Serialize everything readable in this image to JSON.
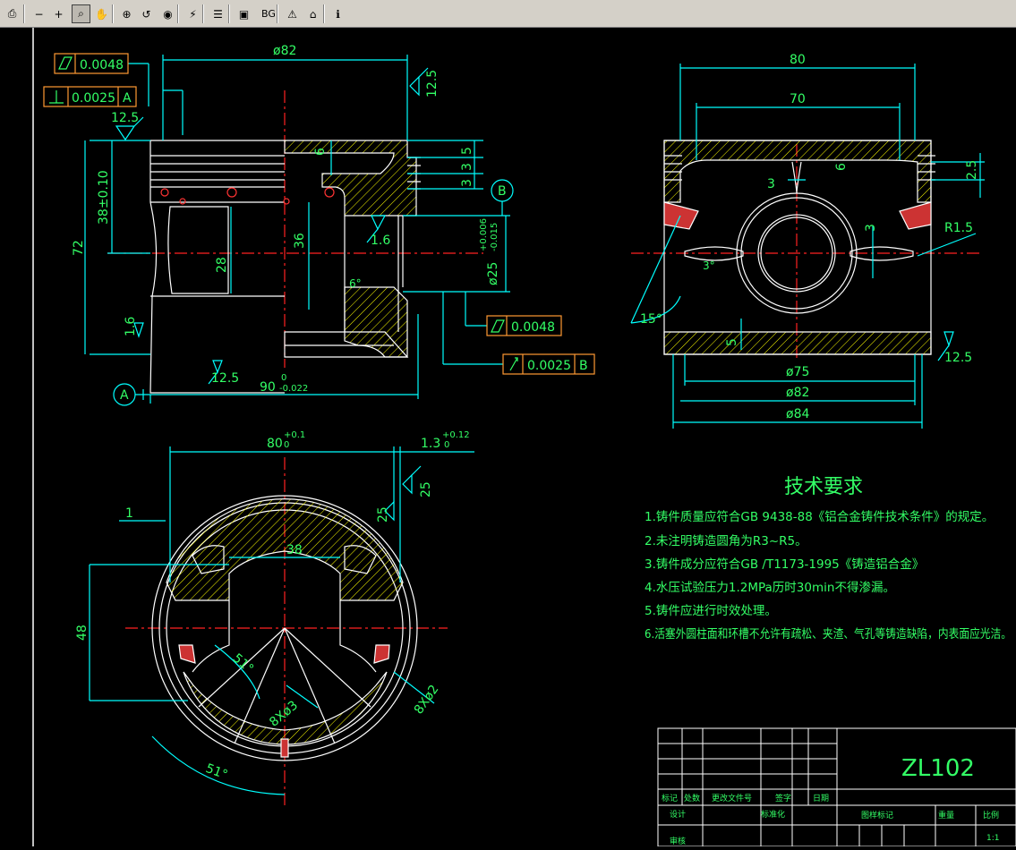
{
  "toolbar": {
    "buttons": [
      {
        "name": "print-icon",
        "glyph": "⎙"
      },
      {
        "name": "zoom-out-icon",
        "glyph": "−"
      },
      {
        "name": "zoom-in-icon",
        "glyph": "+"
      },
      {
        "name": "zoom-window-icon",
        "glyph": "⌕"
      },
      {
        "name": "pan-icon",
        "glyph": "✋"
      },
      {
        "name": "zoom-extents-icon",
        "glyph": "⊕"
      },
      {
        "name": "zoom-previous-icon",
        "glyph": "↺"
      },
      {
        "name": "orbit-icon",
        "glyph": "◉"
      },
      {
        "name": "redraw-icon",
        "glyph": "⚡"
      },
      {
        "name": "layers-icon",
        "glyph": "☰"
      },
      {
        "name": "view-icon",
        "glyph": "▣"
      },
      {
        "name": "background-label",
        "glyph": "BG"
      },
      {
        "name": "warning-icon",
        "glyph": "⚠"
      },
      {
        "name": "home-icon",
        "glyph": "⌂"
      },
      {
        "name": "info-icon",
        "glyph": "ℹ"
      }
    ]
  },
  "drawing": {
    "front": {
      "dia82": "ø82",
      "r125_right": "12.5",
      "r125_left": "12.5",
      "dim_38": "38±0.10",
      "dim_72": "72",
      "dim_28": "28",
      "dim_36": "36",
      "dim_6": "6",
      "dim_5": "5",
      "dim_3a": "3",
      "dim_3b": "3",
      "dim_16a": "1.6",
      "dim_16b": "1.6",
      "dim_6deg": "6°",
      "dia25": "ø25",
      "tol25_up": "+0.006",
      "tol25_dn": "-0.015",
      "r125_bottom": "12.5",
      "dim90": "90",
      "tol90_up": "0",
      "tol90_dn": "-0.022",
      "datum_a": "A",
      "datum_b": "B"
    },
    "fcf": {
      "flat_value": "0.0048",
      "perp_value": "0.0025",
      "perp_datum": "A",
      "flat2_value": "0.0048",
      "runout_value": "0.0025",
      "runout_datum": "B"
    },
    "side": {
      "dim80": "80",
      "dim70": "70",
      "dim6": "6",
      "dim3a": "3",
      "dim3b": "3",
      "dim25": "2.5",
      "r15": "R1.5",
      "ang3": "3°",
      "ang15": "15°",
      "dim5": "5",
      "r125": "12.5",
      "dia75": "ø75",
      "dia82": "ø82",
      "dia84": "ø84"
    },
    "bottom": {
      "dim80": "80",
      "tol80_up": "+0.1",
      "tol80_dn": "0",
      "dim13": "1.3",
      "tol13_up": "+0.12",
      "tol13_dn": "0",
      "r25a": "25",
      "r25b": "25",
      "dim1": "1",
      "dim38": "38",
      "dim48": "48",
      "ang51a": "51°",
      "ang51b": "51°",
      "holes3": "8Xø3",
      "holes2": "8Xø2"
    },
    "notes": {
      "title": "技术要求",
      "items": [
        "1.铸件质量应符合GB 9438-88《铝合金铸件技术条件》的规定。",
        "2.未注明铸造圆角为R3~R5。",
        "3.铸件成分应符合GB /T1173-1995《铸造铝合金》",
        "4.水压试验压力1.2MPa历时30min不得渗漏。",
        "5.铸件应进行时效处理。",
        "6.活塞外圆柱面和环槽不允许有疏松、夹渣、气孔等铸造缺陷，内表面应光洁。"
      ]
    },
    "title_block": {
      "material": "ZL102",
      "h_mark": "标记",
      "h_count": "处数",
      "h_docno": "更改文件号",
      "h_sign": "签字",
      "h_date": "日期",
      "design": "设计",
      "standardize": "标准化",
      "review": "审核",
      "stage_mark": "图样标记",
      "weight": "重量",
      "scale": "比例",
      "scale_value": "1:1"
    }
  },
  "colors": {
    "outline": "#ffffff",
    "dimension": "#00ffff",
    "text": "#33ff66",
    "center": "#ff2222",
    "hatch": "#ffff00",
    "fcf_border": "#ff9933",
    "toolbar": "#d4d0c8"
  }
}
